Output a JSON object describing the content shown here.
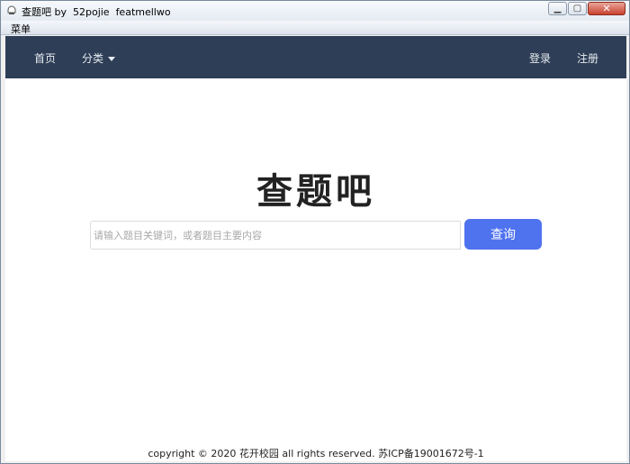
{
  "window": {
    "title": "查题吧 by  52pojie  featmellwo",
    "menu_label": "菜单",
    "minimize_glyph": "▁",
    "maximize_glyph": "▢",
    "close_glyph": "✕"
  },
  "navbar": {
    "home": "首页",
    "category": "分类",
    "login": "登录",
    "register": "注册"
  },
  "brand": "查题吧",
  "search": {
    "placeholder": "请输入题目关键词，或者题目主要内容",
    "value": "",
    "button_label": "查询"
  },
  "footer": "copyright © 2020 花开校园 all rights reserved. 苏ICP备19001672号-1",
  "colors": {
    "navbar_bg": "#2e3e56",
    "search_button": "#4f72ef"
  }
}
